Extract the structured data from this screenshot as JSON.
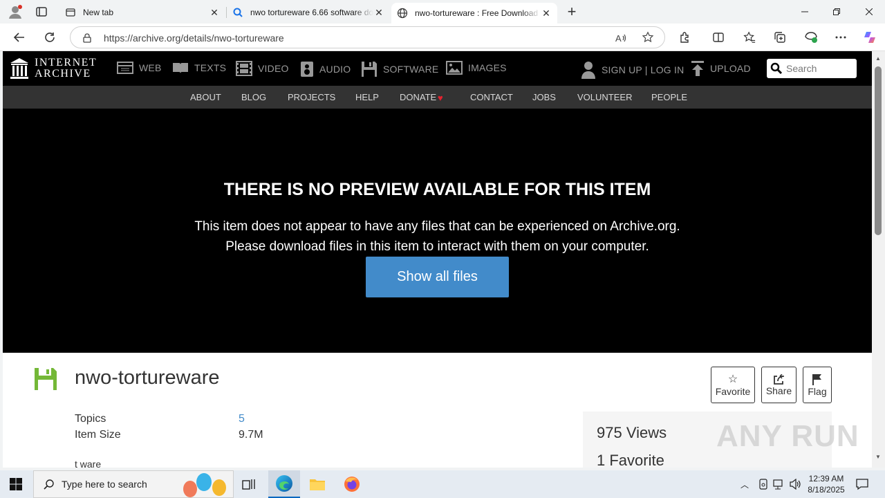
{
  "browser": {
    "tabs": [
      {
        "title": "New tab",
        "active": false
      },
      {
        "title": "nwo tortureware 6.66 software do",
        "active": false
      },
      {
        "title": "nwo-tortureware : Free Download",
        "active": true
      }
    ],
    "url": "https://archive.org/details/nwo-tortureware"
  },
  "ia_header": {
    "logo_line1": "INTERNET",
    "logo_line2": "ARCHIVE",
    "nav": [
      {
        "label": "WEB",
        "icon": "web-icon"
      },
      {
        "label": "TEXTS",
        "icon": "texts-icon"
      },
      {
        "label": "VIDEO",
        "icon": "video-icon"
      },
      {
        "label": "AUDIO",
        "icon": "audio-icon"
      },
      {
        "label": "SOFTWARE",
        "icon": "software-icon"
      },
      {
        "label": "IMAGES",
        "icon": "images-icon"
      }
    ],
    "signup": "SIGN UP | LOG IN",
    "upload": "UPLOAD",
    "search_placeholder": "Search",
    "subnav": [
      "ABOUT",
      "BLOG",
      "PROJECTS",
      "HELP",
      "DONATE",
      "CONTACT",
      "JOBS",
      "VOLUNTEER",
      "PEOPLE"
    ]
  },
  "preview": {
    "title": "THERE IS NO PREVIEW AVAILABLE FOR THIS ITEM",
    "line1": "This item does not appear to have any files that can be experienced on Archive.org.",
    "line2": "Please download files in this item to interact with them on your computer.",
    "button": "Show all files"
  },
  "item": {
    "title": "nwo-tortureware",
    "actions": [
      "Favorite",
      "Share",
      "Flag"
    ],
    "metadata": [
      {
        "label": "Topics",
        "value": "5"
      },
      {
        "label": "Item Size",
        "value": "9.7M"
      }
    ],
    "description": "t ware",
    "views": "975 Views",
    "favorites": "1 Favorite"
  },
  "taskbar": {
    "search_placeholder": "Type here to search",
    "time": "12:39 AM",
    "date": "8/18/2025"
  },
  "watermark": "ANY RUN",
  "colors": {
    "accent": "#428bca",
    "ia_black": "#000000",
    "ia_gray": "#333333",
    "donate_heart": "#e3222f",
    "software_green": "#74b837"
  }
}
